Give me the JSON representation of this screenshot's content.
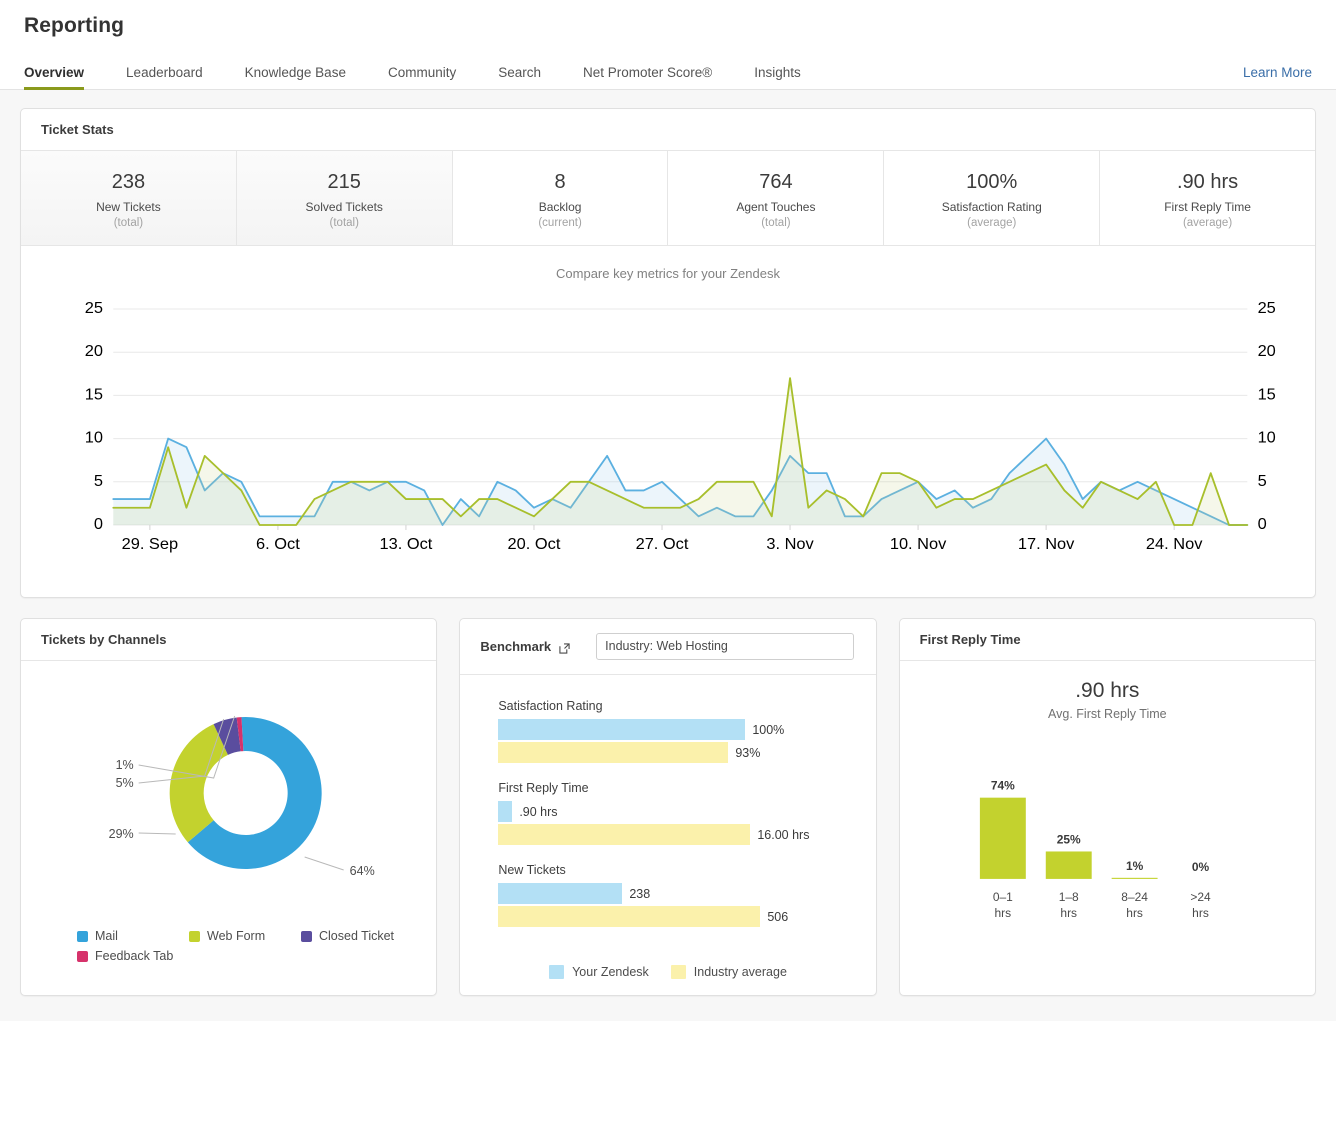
{
  "header": {
    "title": "Reporting",
    "learn_more": "Learn More",
    "tabs": [
      {
        "label": "Overview",
        "active": true
      },
      {
        "label": "Leaderboard",
        "active": false
      },
      {
        "label": "Knowledge Base",
        "active": false
      },
      {
        "label": "Community",
        "active": false
      },
      {
        "label": "Search",
        "active": false
      },
      {
        "label": "Net Promoter Score®",
        "active": false
      },
      {
        "label": "Insights",
        "active": false
      }
    ]
  },
  "ticket_stats": {
    "title": "Ticket Stats",
    "items": [
      {
        "value": "238",
        "label": "New Tickets",
        "sub": "(total)"
      },
      {
        "value": "215",
        "label": "Solved Tickets",
        "sub": "(total)"
      },
      {
        "value": "8",
        "label": "Backlog",
        "sub": "(current)"
      },
      {
        "value": "764",
        "label": "Agent Touches",
        "sub": "(total)"
      },
      {
        "value": "100%",
        "label": "Satisfaction Rating",
        "sub": "(average)"
      },
      {
        "value": ".90 hrs",
        "label": "First Reply Time",
        "sub": "(average)"
      }
    ]
  },
  "channels": {
    "title": "Tickets by Channels",
    "legend": [
      {
        "label": "Mail",
        "color": "#34a3db"
      },
      {
        "label": "Web Form",
        "color": "#c3d22e"
      },
      {
        "label": "Closed Ticket",
        "color": "#5a4d9e"
      },
      {
        "label": "Feedback Tab",
        "color": "#d6326b"
      }
    ],
    "callouts": [
      "1%",
      "5%",
      "29%",
      "64%"
    ]
  },
  "benchmark": {
    "title": "Benchmark",
    "industry_select": "Industry: Web Hosting",
    "external_link_icon": "external-link-icon",
    "groups": [
      {
        "label": "Satisfaction Rating",
        "mine": "100%",
        "industry": "93%",
        "mine_frac": 1.0,
        "ind_frac": 0.93
      },
      {
        "label": "First Reply Time",
        "mine": ".90 hrs",
        "industry": "16.00 hrs",
        "mine_frac": 0.056,
        "ind_frac": 1.0
      },
      {
        "label": "New Tickets",
        "mine": "238",
        "industry": "506",
        "mine_frac": 0.47,
        "ind_frac": 1.0
      }
    ],
    "legend": [
      {
        "label": "Your Zendesk",
        "color": "#b3e0f5"
      },
      {
        "label": "Industry average",
        "color": "#fbf1ab"
      }
    ]
  },
  "first_reply_time": {
    "title": "First Reply Time",
    "big_value": ".90 hrs",
    "sub_label": "Avg. First Reply Time"
  },
  "colors": {
    "accent_green": "#8a9a1c",
    "series_blue": "#5bb0e0",
    "series_green": "#a8bf2c",
    "link_blue": "#3a6ea8",
    "bar_green": "#c3d22e"
  },
  "chart_data": [
    {
      "type": "line",
      "title": "Compare key metrics for your Zendesk",
      "xlabel": "",
      "ylabel": "",
      "ylim": [
        0,
        25
      ],
      "y_ticks": [
        0,
        5,
        10,
        15,
        20,
        25
      ],
      "grid": true,
      "legend_position": "none",
      "x_tick_labels": [
        "29. Sep",
        "6. Oct",
        "13. Oct",
        "20. Oct",
        "27. Oct",
        "3. Nov",
        "10. Nov",
        "17. Nov",
        "24. Nov"
      ],
      "x_tick_indices": [
        2,
        9,
        16,
        23,
        30,
        37,
        44,
        51,
        58
      ],
      "left_axis_color": "#6f9ac4",
      "right_axis_color": "#9aad3c",
      "series": [
        {
          "name": "New Tickets",
          "color": "#5bb0e0",
          "axis": "left",
          "values": [
            3,
            3,
            3,
            10,
            9,
            4,
            6,
            5,
            1,
            1,
            1,
            1,
            5,
            5,
            4,
            5,
            5,
            4,
            0,
            3,
            1,
            5,
            4,
            2,
            3,
            2,
            5,
            8,
            4,
            4,
            5,
            3,
            1,
            2,
            1,
            1,
            4,
            8,
            6,
            6,
            1,
            1,
            3,
            4,
            5,
            3,
            4,
            2,
            3,
            6,
            8,
            10,
            7,
            3,
            5,
            4,
            5,
            4,
            3,
            2,
            1,
            0,
            0
          ]
        },
        {
          "name": "Agent Touches",
          "color": "#a8bf2c",
          "axis": "right",
          "values": [
            2,
            2,
            2,
            9,
            2,
            8,
            6,
            4,
            0,
            0,
            0,
            3,
            4,
            5,
            5,
            5,
            3,
            3,
            3,
            1,
            3,
            3,
            2,
            1,
            3,
            5,
            5,
            4,
            3,
            2,
            2,
            2,
            3,
            5,
            5,
            5,
            1,
            17,
            2,
            4,
            3,
            1,
            6,
            6,
            5,
            2,
            3,
            3,
            4,
            5,
            6,
            7,
            4,
            2,
            5,
            4,
            3,
            5,
            0,
            0,
            6,
            0,
            0
          ]
        }
      ]
    },
    {
      "type": "pie",
      "title": "Tickets by Channels",
      "labels": [
        "Mail",
        "Web Form",
        "Closed Ticket",
        "Feedback Tab"
      ],
      "values": [
        64,
        29,
        5,
        1
      ],
      "value_labels": [
        "64%",
        "29%",
        "5%",
        "1%"
      ],
      "colors": [
        "#34a3db",
        "#c3d22e",
        "#5a4d9e",
        "#d6326b"
      ],
      "legend_position": "bottom",
      "donut": true
    },
    {
      "type": "bar",
      "title": "Benchmark",
      "orientation": "horizontal",
      "categories": [
        "Satisfaction Rating",
        "First Reply Time",
        "New Tickets"
      ],
      "series": [
        {
          "name": "Your Zendesk",
          "color": "#b3e0f5",
          "values": [
            100,
            0.9,
            238
          ],
          "value_labels": [
            "100%",
            ".90 hrs",
            "238"
          ]
        },
        {
          "name": "Industry average",
          "color": "#fbf1ab",
          "values": [
            93,
            16.0,
            506
          ],
          "value_labels": [
            "93%",
            "16.00 hrs",
            "506"
          ]
        }
      ],
      "legend_position": "bottom"
    },
    {
      "type": "bar",
      "title": "First Reply Time",
      "categories": [
        "0–1\nhrs",
        "1–8\nhrs",
        "8–24\nhrs",
        ">24\nhrs"
      ],
      "category_lines": [
        [
          "0–1",
          "hrs"
        ],
        [
          "1–8",
          "hrs"
        ],
        [
          "8–24",
          "hrs"
        ],
        [
          ">24",
          "hrs"
        ]
      ],
      "values": [
        74,
        25,
        1,
        0
      ],
      "value_labels": [
        "74%",
        "25%",
        "1%",
        "0%"
      ],
      "color": "#c3d22e",
      "ylim": [
        0,
        100
      ],
      "grid": false,
      "legend_position": "none"
    }
  ]
}
